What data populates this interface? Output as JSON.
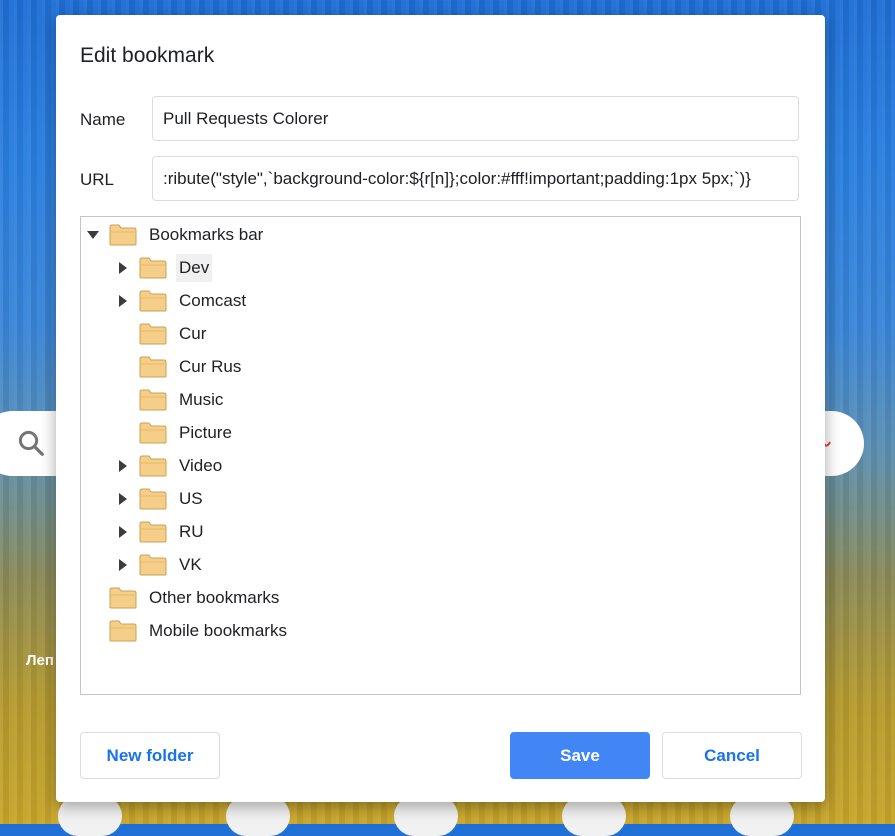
{
  "dialog": {
    "title": "Edit bookmark",
    "name_label": "Name",
    "name_value": "Pull Requests Colorer",
    "url_label": "URL",
    "url_value": ":ribute(\"style\",`background-color:${r[n]};color:#fff!important;padding:1px 5px;`)}"
  },
  "tree": {
    "root": {
      "label": "Bookmarks bar",
      "expanded": true
    },
    "children": [
      {
        "label": "Dev",
        "has_children": true,
        "selected": true
      },
      {
        "label": "Comcast",
        "has_children": true
      },
      {
        "label": "Cur",
        "has_children": false
      },
      {
        "label": "Cur Rus",
        "has_children": false
      },
      {
        "label": "Music",
        "has_children": false
      },
      {
        "label": "Picture",
        "has_children": false
      },
      {
        "label": "Video",
        "has_children": true
      },
      {
        "label": "US",
        "has_children": true
      },
      {
        "label": "RU",
        "has_children": true
      },
      {
        "label": "VK",
        "has_children": true
      }
    ],
    "siblings": [
      {
        "label": "Other bookmarks"
      },
      {
        "label": "Mobile bookmarks"
      }
    ]
  },
  "buttons": {
    "new_folder": "New folder",
    "save": "Save",
    "cancel": "Cancel"
  },
  "background": {
    "partial_text": "Леп"
  },
  "colors": {
    "accent": "#1a73e8",
    "primary_button": "#4285f4",
    "folder": "#f5cf8a"
  }
}
